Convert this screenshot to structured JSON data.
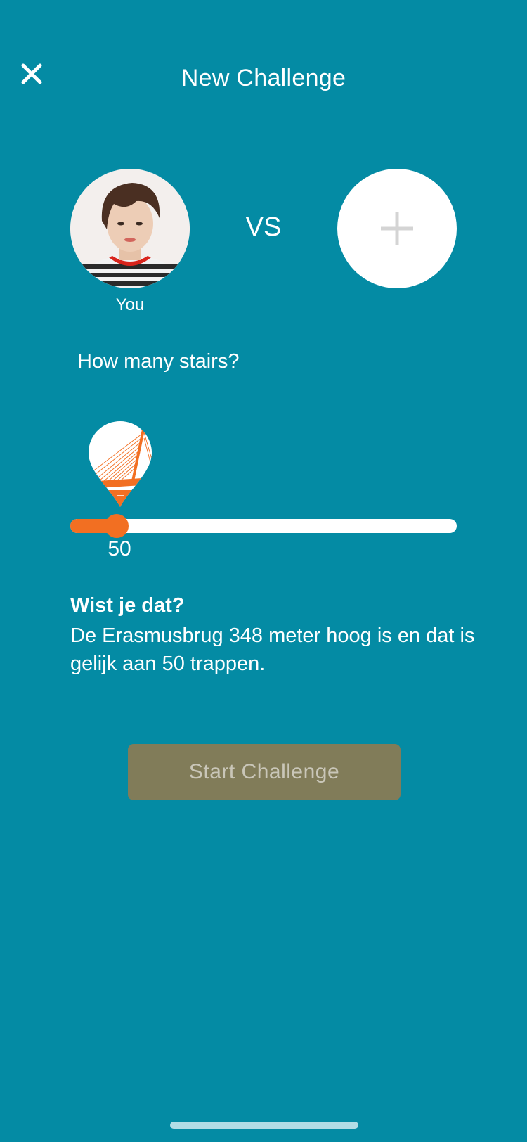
{
  "header": {
    "title": "New Challenge",
    "close_icon": "close-icon"
  },
  "participants": {
    "you_label": "You",
    "vs_label": "VS",
    "add_opponent_icon": "plus-icon"
  },
  "stairs": {
    "question": "How many stairs?",
    "slider_value": "50",
    "slider_fraction": 0.12,
    "pin_icon": "erasmus-bridge-pin-icon"
  },
  "info": {
    "heading": "Wist je dat?",
    "body": "De Erasmusbrug 348 meter hoog is en dat is gelijk aan 50 trappen."
  },
  "actions": {
    "start_label": "Start Challenge"
  },
  "colors": {
    "background": "#048ba4",
    "accent": "#f26f22",
    "button_disabled": "#817c59",
    "button_text_disabled": "#c9c6b8"
  }
}
